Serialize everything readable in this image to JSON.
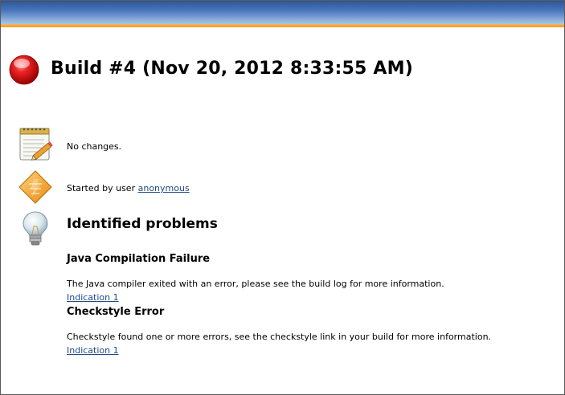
{
  "build": {
    "title": "Build #4 (Nov 20, 2012 8:33:55 AM)",
    "status_icon": "red-ball-icon"
  },
  "changes": {
    "icon": "notepad-icon",
    "text": "No changes."
  },
  "cause": {
    "icon": "user-diamond-icon",
    "prefix": "Started by user ",
    "user_link": "anonymous"
  },
  "problems": {
    "icon": "lightbulb-icon",
    "heading": "Identified problems",
    "items": [
      {
        "title": "Java Compilation Failure",
        "description": "The Java compiler exited with an error, please see the build log for more information.",
        "link": "Indication 1"
      },
      {
        "title": "Checkstyle Error",
        "description": "Checkstyle found one or more errors, see the checkstyle link in your build for more information.",
        "link": "Indication 1"
      }
    ]
  },
  "colors": {
    "header_blue": "#2c5293",
    "header_stripe": "#f39a1b",
    "link": "#204a87",
    "failure_red": "#d60000"
  }
}
